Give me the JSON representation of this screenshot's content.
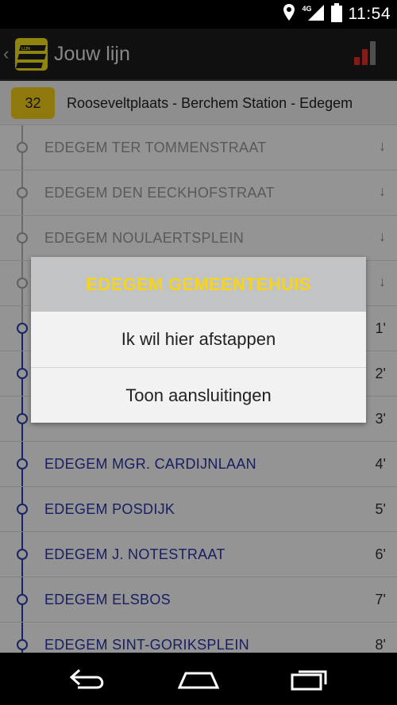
{
  "status_bar": {
    "network": "4G",
    "clock": "11:54",
    "icons": [
      "location-icon",
      "signal-strength-icon",
      "battery-icon"
    ]
  },
  "action_bar": {
    "title": "Jouw lijn",
    "logo_text": "LIJN",
    "icons": [
      "back-caret-icon",
      "app-logo",
      "signal-bars-icon"
    ]
  },
  "route": {
    "line_number": "32",
    "name": "Rooseveltplaats - Berchem Station - Edegem"
  },
  "stops": [
    {
      "name": "EDEGEM TER TOMMENSTRAAT",
      "time": "",
      "past": true
    },
    {
      "name": "EDEGEM DEN EECKHOFSTRAAT",
      "time": "",
      "past": true
    },
    {
      "name": "EDEGEM NOULAERTSPLEIN",
      "time": "",
      "past": true
    },
    {
      "name": "",
      "time": "",
      "past": true
    },
    {
      "name": "",
      "time": "1'",
      "past": false
    },
    {
      "name": "",
      "time": "2'",
      "past": false
    },
    {
      "name": "",
      "time": "3'",
      "past": false
    },
    {
      "name": "EDEGEM MGR. CARDIJNLAAN",
      "time": "4'",
      "past": false
    },
    {
      "name": "EDEGEM POSDIJK",
      "time": "5'",
      "past": false
    },
    {
      "name": "EDEGEM J. NOTESTRAAT",
      "time": "6'",
      "past": false
    },
    {
      "name": "EDEGEM ELSBOS",
      "time": "7'",
      "past": false
    },
    {
      "name": "EDEGEM SINT-GORIKSPLEIN",
      "time": "8'",
      "past": false
    }
  ],
  "dialog": {
    "title": "EDEGEM GEMEENTEHUIS",
    "options": [
      "Ik wil hier afstappen",
      "Toon aansluitingen"
    ]
  },
  "nav_bar": {
    "buttons": [
      "back-icon",
      "home-icon",
      "recent-apps-icon"
    ]
  },
  "colors": {
    "accent_yellow": "#f7d117",
    "stop_blue": "#2a35a8",
    "past_grey": "#9a9a9a",
    "dialog_title_bg": "#c2c3c5"
  }
}
